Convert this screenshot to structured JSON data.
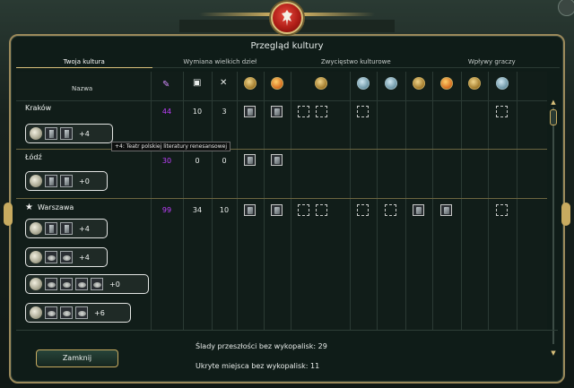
{
  "window": {
    "title": "Przegląd kultury",
    "close_label": "Zamknij"
  },
  "tabs": [
    {
      "label": "Twoja kultura",
      "active": true
    },
    {
      "label": "Wymiana wielkich dzieł",
      "active": false
    },
    {
      "label": "Zwycięstwo kulturowe",
      "active": false
    },
    {
      "label": "Wpływy graczy",
      "active": false
    }
  ],
  "table": {
    "header_name": "Nazwa",
    "column_icons": [
      "culture-icon",
      "tourism-icon",
      "great-works-icon",
      "wonder-icon",
      "wonder-icon",
      "museum-icon",
      "wonder-icon",
      "wonder-icon",
      "wonder-icon",
      "wonder-icon",
      "wonder-icon",
      "wonder-icon"
    ],
    "cities": [
      {
        "name": "Kraków",
        "culture": "44",
        "tourism": "10",
        "great_works": "3",
        "capital": false,
        "buildings": [
          {
            "slots": 2,
            "bonus": "+4"
          }
        ]
      },
      {
        "name": "Łódź",
        "culture": "30",
        "tourism": "0",
        "great_works": "0",
        "capital": false,
        "buildings": [
          {
            "slots": 2,
            "bonus": "+0"
          }
        ]
      },
      {
        "name": "Warszawa",
        "culture": "99",
        "tourism": "34",
        "great_works": "10",
        "capital": true,
        "buildings": [
          {
            "slots": 2,
            "bonus": "+4"
          },
          {
            "slots": 2,
            "bonus": "+4"
          },
          {
            "slots": 4,
            "bonus": "+0"
          },
          {
            "slots": 3,
            "bonus": "+6"
          }
        ]
      }
    ]
  },
  "tooltip": "+4: Teatr polskiej literatury renesansowej",
  "footer": {
    "artifacts": "Ślady przeszłości bez wykopalisk: 29",
    "hidden_sites": "Ukryte miejsca bez wykopalisk: 11"
  },
  "colors": {
    "accent": "#c8ab60",
    "culture_purple": "#c040ff",
    "panel": "#0f1c18"
  }
}
